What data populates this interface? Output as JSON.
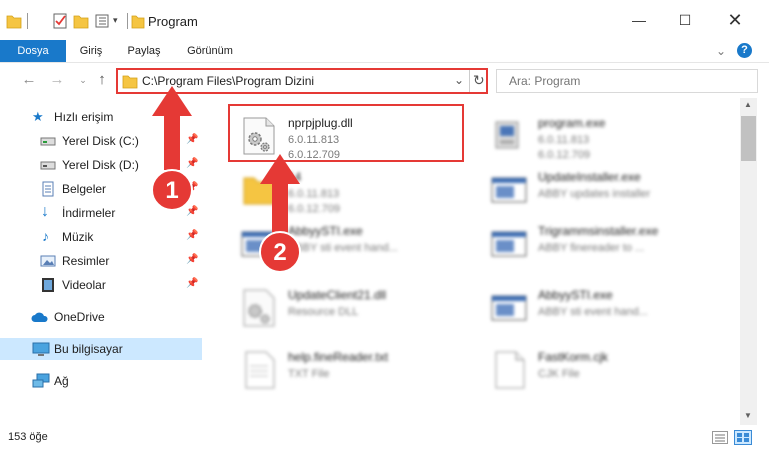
{
  "window": {
    "title": "Program"
  },
  "ribbon": {
    "tabs": [
      "Dosya",
      "Giriş",
      "Paylaş",
      "Görünüm"
    ]
  },
  "address": {
    "path": "C:\\Program Files\\Program Dizini"
  },
  "search": {
    "placeholder": "Ara: Program"
  },
  "sidebar": {
    "items": [
      {
        "label": "Hızlı erişim",
        "icon": "star-icon"
      },
      {
        "label": "Yerel Disk (C:)",
        "icon": "drive-icon"
      },
      {
        "label": "Yerel Disk (D:)",
        "icon": "drive-icon"
      },
      {
        "label": "Belgeler",
        "icon": "document-icon"
      },
      {
        "label": "İndirmeler",
        "icon": "download-icon"
      },
      {
        "label": "Müzik",
        "icon": "music-icon"
      },
      {
        "label": "Resimler",
        "icon": "picture-icon"
      },
      {
        "label": "Videolar",
        "icon": "video-icon"
      },
      {
        "label": "OneDrive",
        "icon": "cloud-icon"
      },
      {
        "label": "Bu bilgisayar",
        "icon": "computer-icon"
      },
      {
        "label": "Ağ",
        "icon": "network-icon"
      }
    ]
  },
  "files": [
    {
      "name": "nprpjplug.dll",
      "line2": "6.0.11.813",
      "line3": "6.0.12.709",
      "icon": "dll-gear-icon"
    },
    {
      "name": "program.exe",
      "line2": "6.0.11.813",
      "line3": "6.0.12.709",
      "icon": "exe-icon"
    },
    {
      "name": "14",
      "line2": "6.0.11.813",
      "line3": "6.0.12.709",
      "icon": "folder-icon"
    },
    {
      "name": "UpdateInstaller.exe",
      "line2": "ABBY updates installer",
      "line3": "",
      "icon": "exe-window-icon"
    },
    {
      "name": "AbbyySTI.exe",
      "line2": "ABBY sti event hand...",
      "line3": "",
      "icon": "exe-window-icon"
    },
    {
      "name": "Trigrammsinstaller.exe",
      "line2": "ABBY finereader to ...",
      "line3": "",
      "icon": "exe-window-icon"
    },
    {
      "name": "UpdateClient21.dll",
      "line2": "Resource DLL",
      "line3": "",
      "icon": "dll-gear-icon"
    },
    {
      "name": "AbbyySTI.exe",
      "line2": "ABBY sti event hand...",
      "line3": "",
      "icon": "exe-window-icon"
    },
    {
      "name": "help.fineReader.txt",
      "line2": "TXT File",
      "line3": "",
      "icon": "text-file-icon"
    },
    {
      "name": "FastKorm.cjk",
      "line2": "CJK File",
      "line3": "",
      "icon": "blank-file-icon"
    }
  ],
  "status": {
    "count": "153 öğe"
  },
  "annotations": {
    "badge1": "1",
    "badge2": "2"
  },
  "colors": {
    "accent": "#1979ca",
    "highlight": "#e53935",
    "selected": "#cce8ff"
  }
}
